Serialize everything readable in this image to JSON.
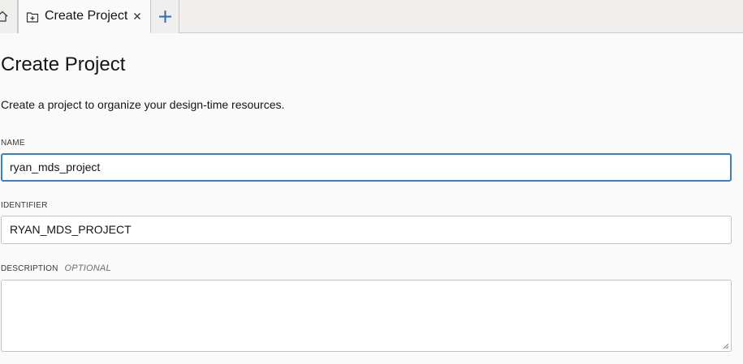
{
  "tabs": {
    "home_icon": "home-icon",
    "active": {
      "label": "Create Project",
      "icon": "new-project-icon",
      "close_icon": "close-icon"
    },
    "add_icon": "plus-icon"
  },
  "page": {
    "title": "Create Project",
    "description": "Create a project to organize your design-time resources."
  },
  "form": {
    "name": {
      "label": "NAME",
      "value": "ryan_mds_project"
    },
    "identifier": {
      "label": "IDENTIFIER",
      "value": "RYAN_MDS_PROJECT"
    },
    "description": {
      "label": "DESCRIPTION",
      "optional_label": "OPTIONAL",
      "value": ""
    }
  },
  "colors": {
    "focus_border": "#3a7ec4",
    "accent_plus": "#2a6fb6"
  }
}
